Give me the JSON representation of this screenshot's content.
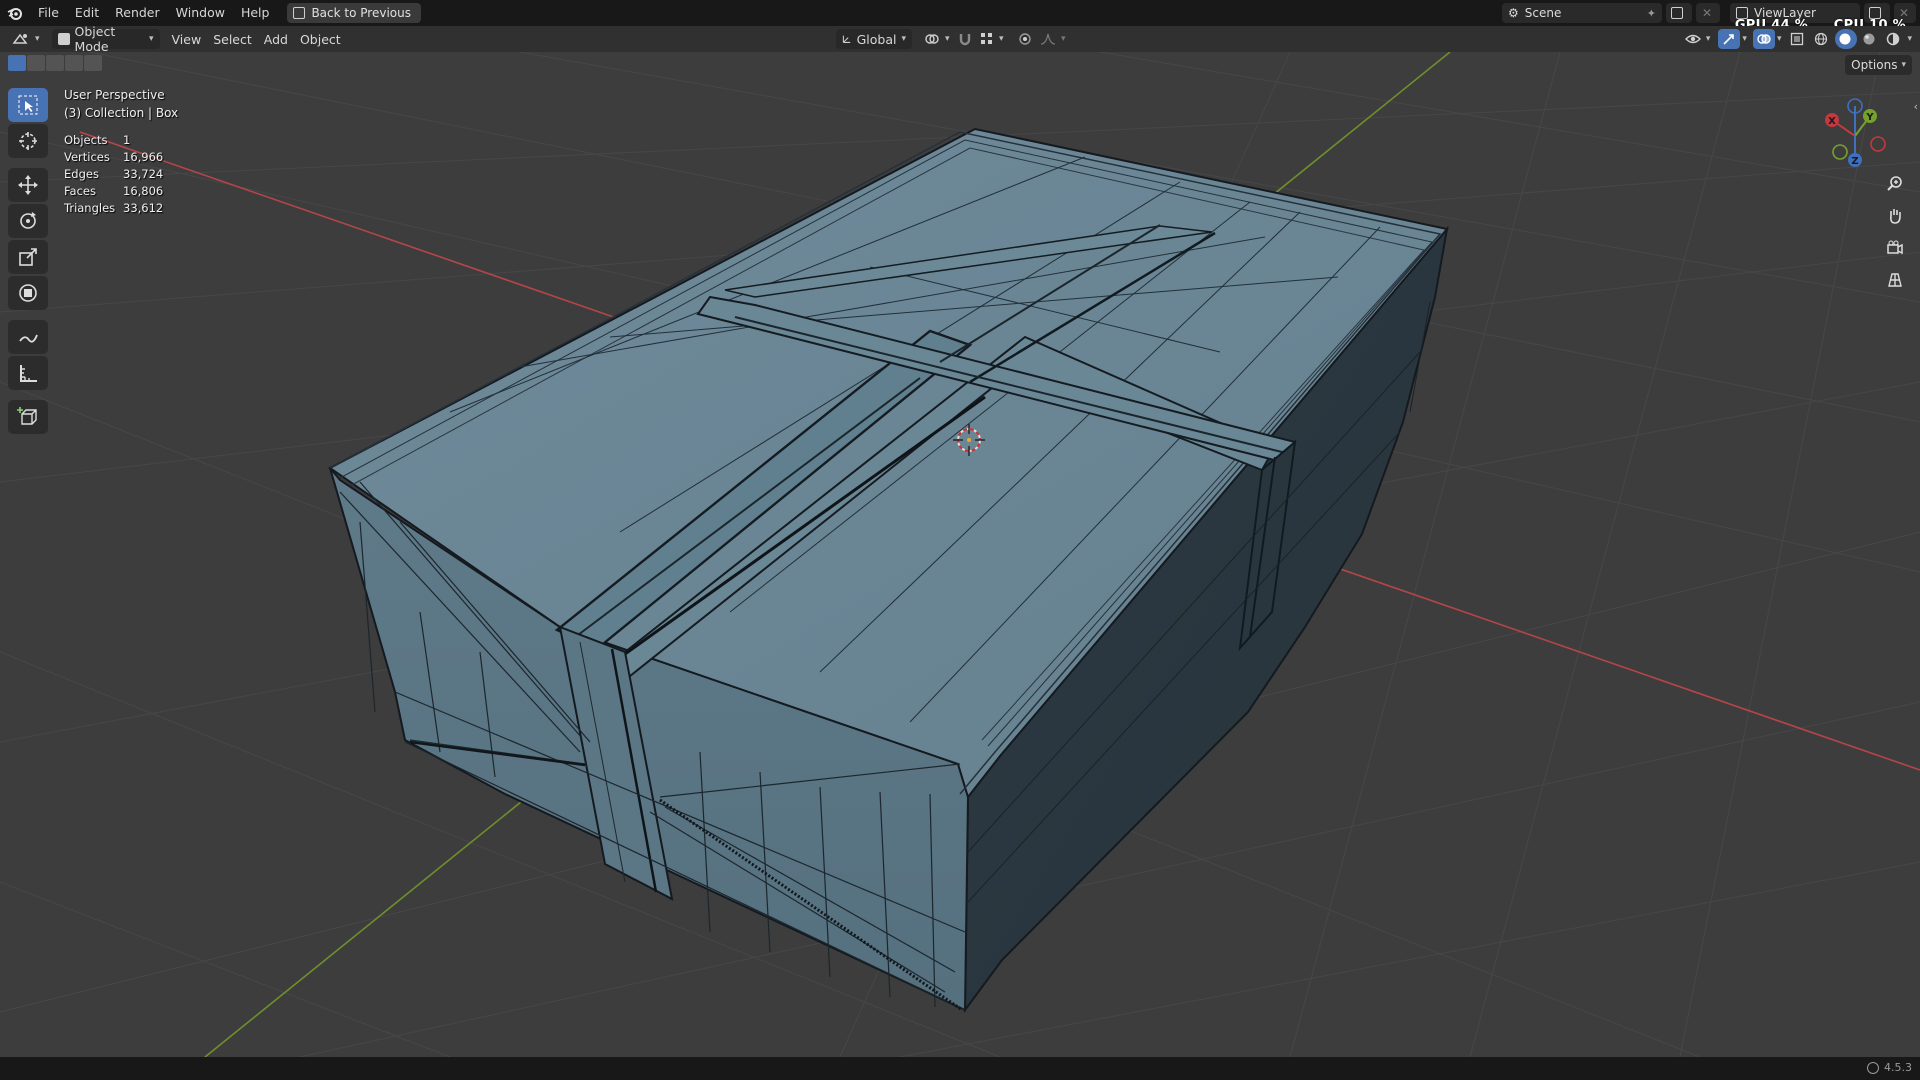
{
  "topbar": {
    "menu": [
      "File",
      "Edit",
      "Render",
      "Window",
      "Help"
    ],
    "back_button": "Back to Previous",
    "scene": "Scene",
    "view_layer": "ViewLayer",
    "gpu": "GPU 44 %",
    "cpu": "CPU 10 %"
  },
  "header": {
    "mode": "Object Mode",
    "menus": [
      "View",
      "Select",
      "Add",
      "Object"
    ],
    "orientation": "Global",
    "options": "Options"
  },
  "overlay": {
    "perspective": "User Perspective",
    "collection": "(3) Collection | Box",
    "stats": [
      {
        "label": "Objects",
        "value": "1"
      },
      {
        "label": "Vertices",
        "value": "16,966"
      },
      {
        "label": "Edges",
        "value": "33,724"
      },
      {
        "label": "Faces",
        "value": "16,806"
      },
      {
        "label": "Triangles",
        "value": "33,612"
      }
    ]
  },
  "gizmo": {
    "x": "X",
    "y": "Y",
    "z": "Z"
  },
  "statusbar": {
    "version": "4.5.3"
  },
  "colors": {
    "accent": "#4772b3",
    "viewport_bg": "#3d3d3d",
    "mesh_top": "#6b8797",
    "mesh_front": "#5a7482",
    "mesh_side": "#2c3840",
    "x_axis": "#c94a4e",
    "y_axis": "#7a9a2f"
  }
}
